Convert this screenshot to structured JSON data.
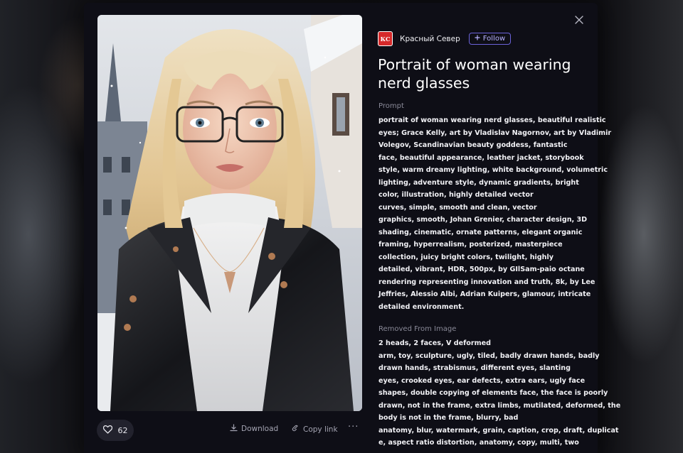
{
  "modal": {
    "author": {
      "avatar_text": "КС",
      "name": "Красный Север",
      "follow_label": "Follow"
    },
    "title": "Portrait of woman wearing nerd glasses",
    "prompt_label": "Prompt",
    "prompt_lines": [
      "portrait of woman wearing nerd glasses, beautiful realistic",
      "eyes; Grace Kelly, art by Vladislav Nagornov, art by Vladimir",
      "Volegov, Scandinavian beauty goddess, fantastic",
      "face, beautiful appearance, leather jacket, storybook",
      "style, warm dreamy lighting, white background, volumetric",
      "lighting, adventure style, dynamic gradients, bright",
      "color, illustration, highly detailed vector",
      "curves, simple, smooth and clean, vector",
      "graphics, smooth, Johan Grenier, character design, 3D",
      "shading, cinematic, ornate patterns, elegant organic",
      "framing, hyperrealism, posterized, masterpiece",
      "collection, juicy bright colors, twilight, highly",
      "detailed, vibrant, HDR, 500px, by GIlSam-paio octane",
      "rendering representing innovation and truth, 8k, by Lee",
      "Jeffries, Alessio Albi, Adrian Kuipers, glamour, intricate",
      "detailed environment."
    ],
    "removed_label": "Removed From Image",
    "removed_lines": [
      "2 heads, 2 faces, V deformed",
      "arm, toy, sculpture, ugly, tiled, badly drawn hands, badly",
      "drawn hands, strabismus, different eyes, slanting",
      "eyes, crooked eyes, ear defects, extra ears, ugly face",
      "shapes, double copying of elements face, the face is poorly",
      "drawn, not in the frame, extra limbs, mutilated, deformed, the",
      "body is not in the frame, blurry, bad",
      "anatomy, blur, watermark, grain, caption, crop, draft, duplicat",
      "e, aspect ratio distortion, anatomy, copy, multi, two"
    ],
    "actions": {
      "likes_count": "62",
      "download_label": "Download",
      "copy_link_label": "Copy link",
      "more_label": "···"
    },
    "icons": {
      "close": "close-icon",
      "heart": "heart-icon",
      "download": "download-icon",
      "link": "link-icon",
      "plus": "plus-icon"
    },
    "colors": {
      "modal_bg": "#0e0e16",
      "accent": "#6b63d9",
      "avatar_bg": "#d6292a"
    }
  }
}
